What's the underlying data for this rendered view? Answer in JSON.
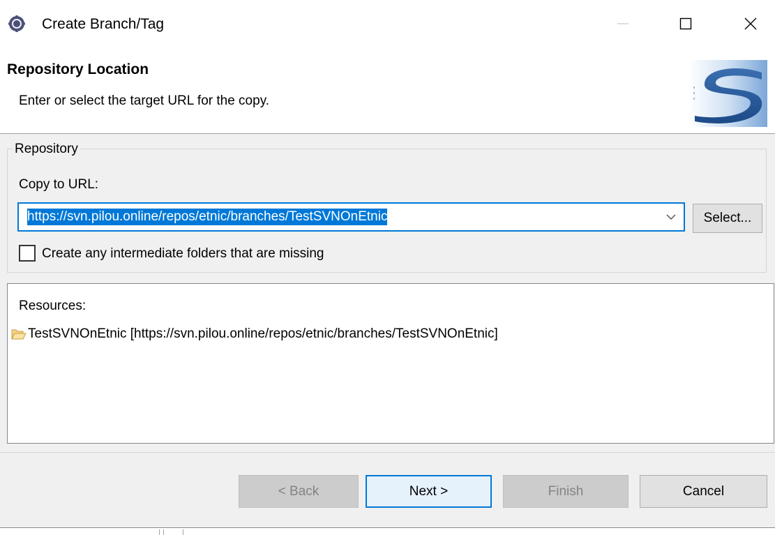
{
  "window": {
    "title": "Create Branch/Tag",
    "icon": "eclipse-gear-icon",
    "controls": [
      "minimize-icon",
      "maximize-icon",
      "close-icon"
    ]
  },
  "banner": {
    "title": "Repository Location",
    "description": "Enter or select the target URL for the copy.",
    "image": "subversion-logo"
  },
  "repository": {
    "group_label": "Repository",
    "copy_label": "Copy to URL:",
    "url_value": "https://svn.pilou.online/repos/etnic/branches/TestSVNOnEtnic",
    "select_button": "Select...",
    "checkbox_label": "Create any intermediate folders that are missing",
    "checkbox_checked": false
  },
  "resources": {
    "label": "Resources:",
    "items": [
      {
        "icon": "folder-open-icon",
        "text": "TestSVNOnEtnic [https://svn.pilou.online/repos/etnic/branches/TestSVNOnEtnic]"
      }
    ]
  },
  "buttons": {
    "back": "< Back",
    "next": "Next >",
    "finish": "Finish",
    "cancel": "Cancel"
  },
  "colors": {
    "accent": "#0078d7",
    "dialog_bg": "#f0f0f0",
    "disabled_text": "#838383"
  }
}
